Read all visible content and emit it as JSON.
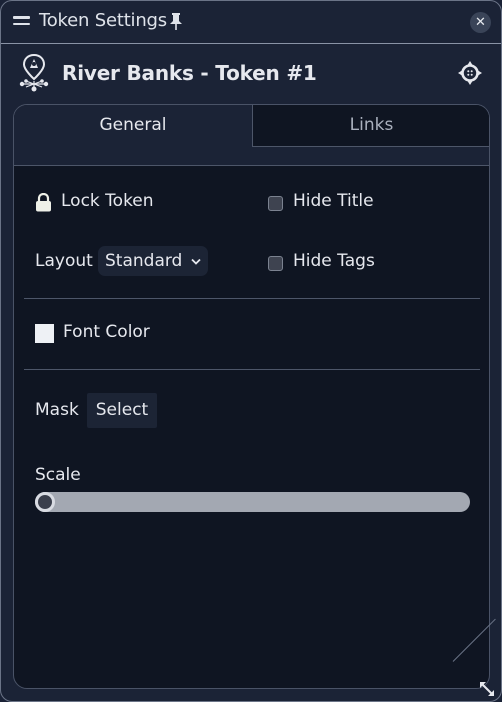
{
  "window": {
    "title": "Token Settings",
    "close_label": "✕"
  },
  "header": {
    "token_title": "River Banks - Token #1"
  },
  "tabs": [
    {
      "label": "General",
      "active": true
    },
    {
      "label": "Links",
      "active": false
    }
  ],
  "general": {
    "lock_token_label": "Lock Token",
    "hide_title_label": "Hide Title",
    "hide_title_checked": false,
    "layout_label": "Layout",
    "layout_value": "Standard",
    "layout_chevron": "⌄",
    "hide_tags_label": "Hide Tags",
    "hide_tags_checked": false,
    "font_color_label": "Font Color",
    "font_color_value": "#eef1f5",
    "mask_label": "Mask",
    "mask_button": "Select",
    "scale_label": "Scale",
    "scale_value_fraction": 0.0
  }
}
